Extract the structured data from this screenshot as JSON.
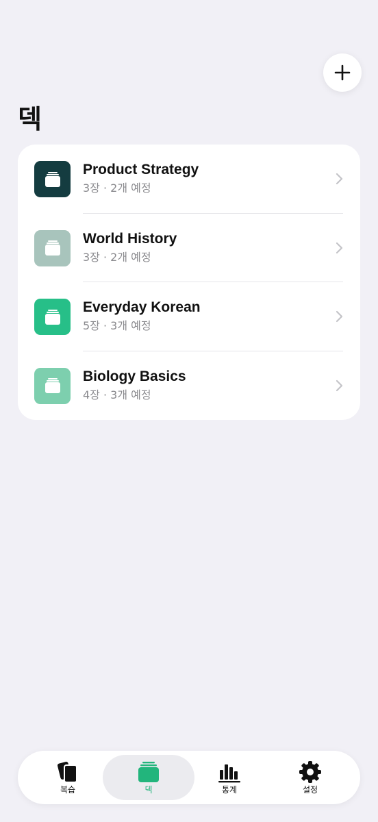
{
  "header": {
    "title": "덱",
    "add_button_icon": "plus-icon"
  },
  "decks": [
    {
      "name": "Product Strategy",
      "subtitle": "3장 · 2개 예정",
      "icon_color": "#143c40",
      "icon": "deck-stack-icon"
    },
    {
      "name": "World History",
      "subtitle": "3장 · 2개 예정",
      "icon_color": "#a8c4bc",
      "icon": "deck-stack-icon"
    },
    {
      "name": "Everyday Korean",
      "subtitle": "5장 · 3개 예정",
      "icon_color": "#27bf88",
      "icon": "deck-stack-icon"
    },
    {
      "name": "Biology Basics",
      "subtitle": "4장 · 3개 예정",
      "icon_color": "#7dcfae",
      "icon": "deck-stack-icon"
    }
  ],
  "tabbar": {
    "tabs": [
      {
        "label": "복습",
        "icon": "cards-icon",
        "active": false
      },
      {
        "label": "덱",
        "icon": "deck-stack-icon",
        "active": true
      },
      {
        "label": "통계",
        "icon": "bar-chart-icon",
        "active": false
      },
      {
        "label": "설정",
        "icon": "gear-icon",
        "active": false
      }
    ]
  },
  "colors": {
    "accent": "#22b57c",
    "background": "#f1f0f6"
  }
}
